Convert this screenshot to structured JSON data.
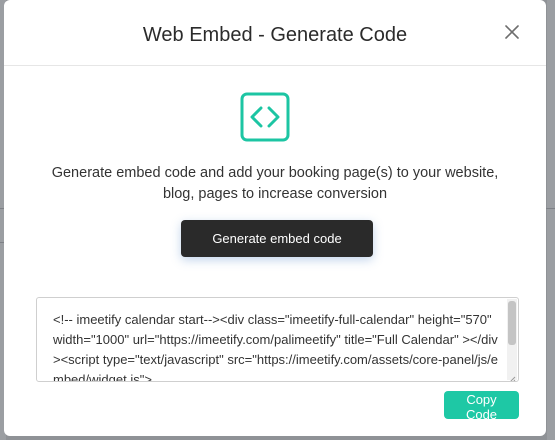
{
  "dialog": {
    "title": "Web Embed - Generate Code",
    "description": "Generate embed code and add your booking page(s) to your website, blog, pages to increase conversion",
    "generate_button": "Generate embed code",
    "copy_button": "Copy Code",
    "embed_code": "<!-- imeetify calendar start--><div  class=\"imeetify-full-calendar\" height=\"570\" width=\"1000\" url=\"https://imeetify.com/palimeetify\" title=\"Full Calendar\" ></div><script type=\"text/javascript\" src=\"https://imeetify.com/assets/core-panel/js/embed/widget.js\">"
  },
  "icons": {
    "close": "close-icon",
    "embed": "code-brackets-icon"
  },
  "colors": {
    "accent": "#1ec8a5",
    "embed_icon": "#1cc5a3",
    "dark_button": "#2a2a2a",
    "backdrop": "#8f9296"
  }
}
